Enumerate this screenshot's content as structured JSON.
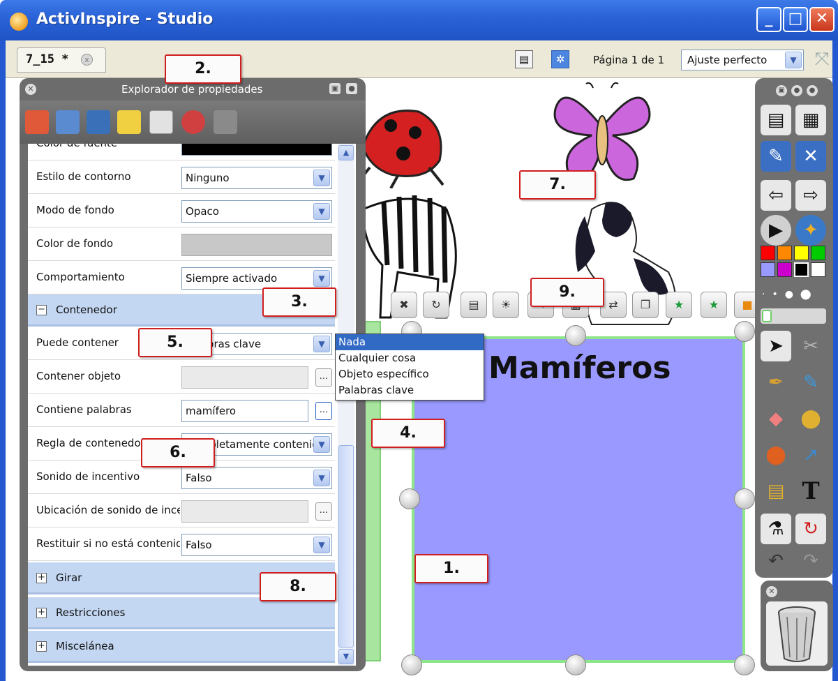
{
  "window": {
    "title": "ActivInspire - Studio",
    "buttons": [
      "_",
      "□",
      "X"
    ]
  },
  "topbar": {
    "tab_label": "7_15 *",
    "tab_close": "x",
    "page_info": "Página 1 de 1",
    "zoom_value": "Ajuste perfecto"
  },
  "explorer": {
    "title": "Explorador de propiedades",
    "rows": [
      {
        "label": "Color de fuente",
        "value": ""
      },
      {
        "label": "Estilo de contorno",
        "value": "Ninguno"
      },
      {
        "label": "Modo de fondo",
        "value": "Opaco"
      },
      {
        "label": "Color de fondo",
        "value": ""
      },
      {
        "label": "Comportamiento",
        "value": "Siempre activado"
      }
    ],
    "container_section": "Contenedor",
    "container_rows": [
      {
        "label": "Puede contener",
        "value": "Palabras clave"
      },
      {
        "label": "Contener objeto",
        "value": ""
      },
      {
        "label": "Contiene palabras",
        "value": "mamífero"
      },
      {
        "label": "Regla de contenedor",
        "value": "Completamente contenido"
      },
      {
        "label": "Sonido de incentivo",
        "value": "Falso"
      },
      {
        "label": "Ubicación de sonido de incentivo",
        "value": ""
      },
      {
        "label": "Restituir si no está contenido",
        "value": "Falso"
      }
    ],
    "sections": [
      "Girar",
      "Restricciones",
      "Miscelánea"
    ],
    "dots": "..."
  },
  "dropdown_options": [
    "Nada",
    "Cualquier cosa",
    "Objeto específico",
    "Palabras clave"
  ],
  "container_title": "Mamíferos",
  "callouts": [
    "1.",
    "2.",
    "3.",
    "4.",
    "5.",
    "6.",
    "7.",
    "8.",
    "9."
  ],
  "palette": [
    "#ff0000",
    "#ff8800",
    "#ffff00",
    "#00cc00",
    "#9999ff",
    "#cc00cc",
    "#000000",
    "#ffffff"
  ],
  "icons": {
    "tab_close": "close-icon",
    "dropdown": "chevron-down-icon",
    "fullscreen": "fullscreen-icon"
  }
}
